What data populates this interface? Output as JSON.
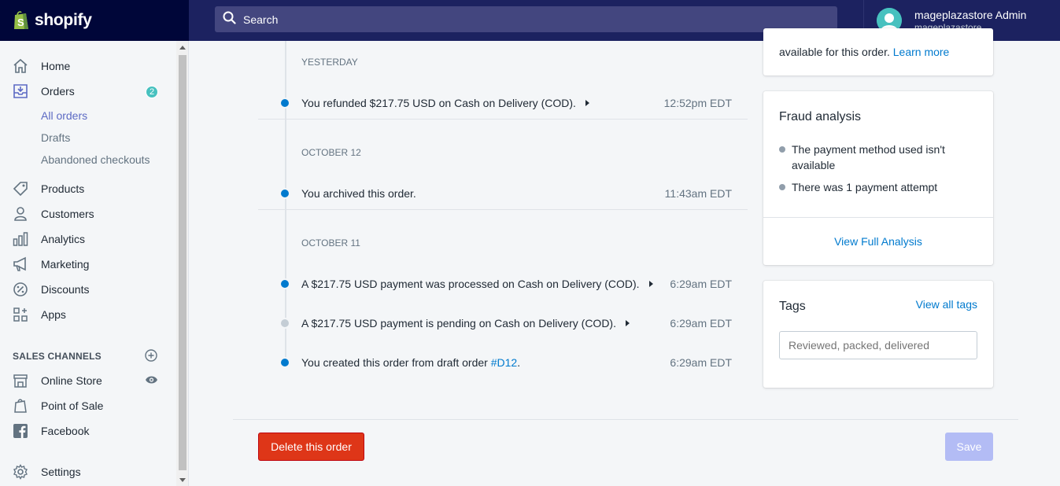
{
  "topbar": {
    "brand": "shopify",
    "search_placeholder": "Search",
    "account_name": "mageplazastore Admin",
    "account_store": "mageplazastore"
  },
  "sidebar": {
    "home": "Home",
    "orders": "Orders",
    "orders_badge": "2",
    "all_orders": "All orders",
    "drafts": "Drafts",
    "abandoned": "Abandoned checkouts",
    "products": "Products",
    "customers": "Customers",
    "analytics": "Analytics",
    "marketing": "Marketing",
    "discounts": "Discounts",
    "apps": "Apps",
    "sales_channels": "SALES CHANNELS",
    "online_store": "Online Store",
    "point_of_sale": "Point of Sale",
    "facebook": "Facebook",
    "settings": "Settings"
  },
  "timeline": {
    "groups": [
      {
        "day": "YESTERDAY",
        "events": [
          {
            "text": "You refunded $217.75 USD on Cash on Delivery (COD).",
            "time": "12:52pm EDT"
          }
        ]
      },
      {
        "day": "OCTOBER 12",
        "events": [
          {
            "text": "You archived this order.",
            "time": "11:43am EDT"
          }
        ]
      },
      {
        "day": "OCTOBER 11",
        "events": [
          {
            "text": "A $217.75 USD payment was processed on Cash on Delivery (COD).",
            "time": "6:29am EDT"
          },
          {
            "text": "A $217.75 USD payment is pending on Cash on Delivery (COD).",
            "time": "6:29am EDT"
          },
          {
            "text_prefix": "You created this order from draft order ",
            "link": "#D12",
            "text_suffix": ".",
            "time": "6:29am EDT"
          }
        ]
      }
    ]
  },
  "cards": {
    "top_partial_text": "available for this order.",
    "top_partial_link": "Learn more",
    "fraud": {
      "title": "Fraud analysis",
      "bullet1_line1": "The payment method used isn't",
      "bullet1_line2": "available",
      "bullet2": "There was 1 payment attempt",
      "link": "View Full Analysis"
    },
    "tags": {
      "title": "Tags",
      "link": "View all tags",
      "placeholder": "Reviewed, packed, delivered"
    }
  },
  "footer": {
    "delete_label": "Delete this order",
    "save_label": "Save"
  },
  "colors": {
    "topbar": "#1c2260",
    "accent": "#5c6ac4",
    "link": "#007ace",
    "danger": "#de3618",
    "badge": "#47c1bf"
  }
}
